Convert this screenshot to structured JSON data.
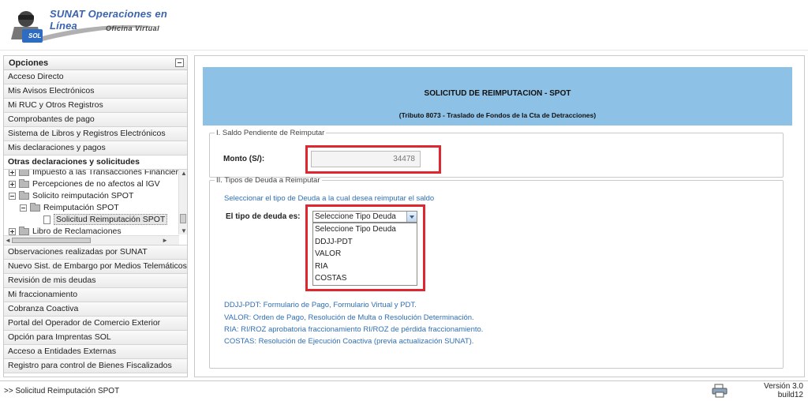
{
  "header": {
    "brand_title": "SUNAT Operaciones en Línea",
    "brand_subtitle": "Oficina Virtual",
    "logo_text": "SOL"
  },
  "sidebar": {
    "title": "Opciones",
    "items_top": [
      "Acceso Directo",
      "Mis Avisos Electrónicos",
      "Mi RUC y Otros Registros",
      "Comprobantes de pago",
      "Sistema de Libros y Registros Electrónicos",
      "Mis declaraciones y pagos",
      "Otras declaraciones y solicitudes"
    ],
    "tree": [
      "Impuesto a las Transacciones Financieras (I",
      "Percepciones de no afectos al IGV",
      "Solicito reimputación SPOT",
      "Reimputación SPOT",
      "Solicitud Reimputación SPOT",
      "Libro de Reclamaciones"
    ],
    "items_bottom": [
      "Observaciones realizadas por SUNAT",
      "Nuevo Sist. de Embargo por Medios Telemáticos",
      "Revisión de mis deudas",
      "Mi fraccionamiento",
      "Cobranza Coactiva",
      "Portal del Operador de Comercio Exterior",
      "Opción para Imprentas SOL",
      "Acceso a Entidades Externas",
      "Registro para control de Bienes Fiscalizados"
    ]
  },
  "main": {
    "title": "SOLICITUD DE REIMPUTACION - SPOT",
    "subtitle": "(Tributo 8073 - Traslado de Fondos de la Cta de Detracciones)",
    "section1": {
      "legend": "I. Saldo Pendiente de Reimputar",
      "monto_label": "Monto (S/):",
      "monto_value": "34478"
    },
    "section2": {
      "legend": "II. Tipos de Deuda a Reimputar",
      "intro": "Seleccionar el tipo de Deuda a la cual desea reimputar el saldo",
      "tipo_label": "El tipo de deuda es:",
      "selected": "Seleccione Tipo Deuda",
      "options": [
        "Seleccione Tipo Deuda",
        "DDJJ-PDT",
        "VALOR",
        "RIA",
        "COSTAS"
      ],
      "help": [
        "DDJJ-PDT: Formulario de Pago, Formulario Virtual y PDT.",
        "VALOR: Orden de Pago, Resolución de Multa o Resolución Determinación.",
        "RIA: RI/ROZ aprobatoria fraccionamiento RI/ROZ de pérdida fraccionamiento.",
        "COSTAS: Resolución de Ejecución Coactiva (previa actualización SUNAT)."
      ]
    }
  },
  "footer": {
    "breadcrumb": ">> Solicitud Reimputación SPOT",
    "version_line1": "Versión 3.0",
    "version_line2": "build12"
  },
  "colors": {
    "banner": "#8ec1e6",
    "highlight": "#e0262f",
    "link": "#2f6fb5",
    "brand": "#3a63b0"
  }
}
